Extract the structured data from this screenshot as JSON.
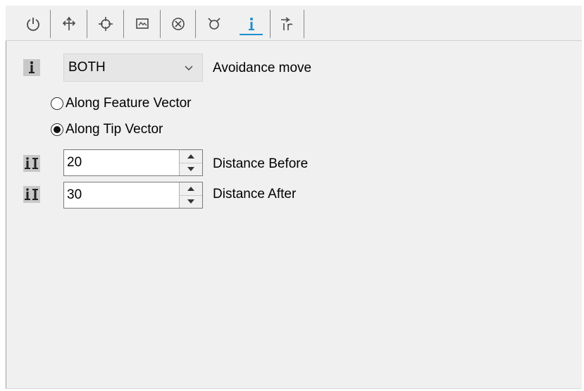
{
  "tabs": [
    {
      "id": "power",
      "icon": "power-icon"
    },
    {
      "id": "move",
      "icon": "move-arrows-icon"
    },
    {
      "id": "target",
      "icon": "crosshair-icon"
    },
    {
      "id": "image",
      "icon": "image-frame-icon"
    },
    {
      "id": "cancel",
      "icon": "x-circle-icon"
    },
    {
      "id": "tool",
      "icon": "tool-tip-icon"
    },
    {
      "id": "avoidance",
      "icon": "info-i-icon",
      "active": true
    },
    {
      "id": "retract",
      "icon": "retract-arrow-icon"
    }
  ],
  "avoidance": {
    "mode_value": "BOTH",
    "mode_label": "Avoidance move"
  },
  "direction": {
    "options": [
      {
        "label": "Along Feature Vector",
        "selected": false
      },
      {
        "label": "Along Tip Vector",
        "selected": true
      }
    ]
  },
  "distance_before": {
    "value": "20",
    "label": "Distance Before"
  },
  "distance_after": {
    "value": "30",
    "label": "Distance After"
  },
  "colors": {
    "accent": "#1f8ecb",
    "panel": "#f0f0f0",
    "icon_bg": "#c8c8c8"
  }
}
